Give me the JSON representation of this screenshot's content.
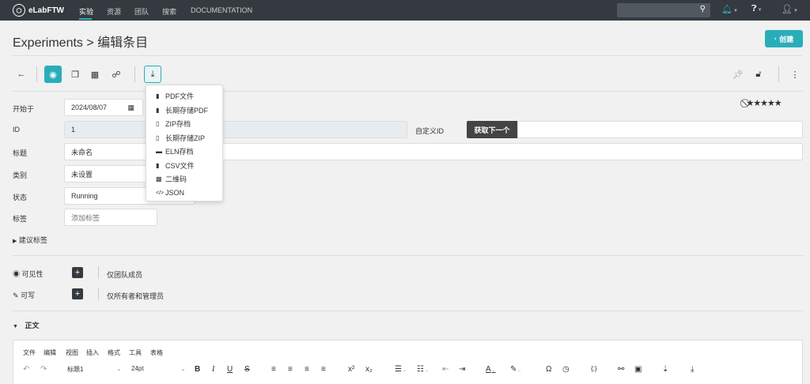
{
  "nav": {
    "brand": "eLabFTW",
    "links": [
      "实验",
      "资源",
      "团队",
      "搜索",
      "DOCUMENTATION"
    ],
    "active": "实验"
  },
  "page": {
    "title": "Experiments > 编辑条目",
    "create_label": "创建"
  },
  "toolbar": {
    "icons": [
      "back-arrow-icon",
      "eye-icon",
      "copy-icon",
      "calendar-icon",
      "link-icon",
      "download-icon",
      "pin-icon",
      "unlock-icon",
      "more-icon"
    ]
  },
  "export_menu": {
    "items": [
      "PDF文件",
      "长期存储PDF",
      "ZIP存档",
      "长期存储ZIP",
      "ELN存档",
      "CSV文件",
      "二维码",
      "JSON"
    ]
  },
  "form": {
    "date_label": "开始于",
    "date_value": "2024/08/07",
    "id_label": "ID",
    "id_value": "1",
    "custom_id_label": "自定义ID",
    "next_button": "获取下一个",
    "title_label": "标题",
    "title_value": "未命名",
    "category_label": "类别",
    "category_value": "未设置",
    "status_label": "状态",
    "status_value": "Running",
    "tags_label": "标签",
    "tags_placeholder": "添加标签",
    "suggest_tags": "建议标签"
  },
  "permissions": {
    "visibility_label": "可见性",
    "visibility_value": "仅团队成员",
    "write_label": "可写",
    "write_value": "仅所有者和管理员"
  },
  "body_section": {
    "label": "正文",
    "menu": [
      "文件",
      "编辑",
      "视图",
      "插入",
      "格式",
      "工具",
      "表格"
    ],
    "block_format": "标题1",
    "font_size": "24pt"
  },
  "colors": {
    "accent": "#29aeb9",
    "navbar": "#343a40"
  }
}
